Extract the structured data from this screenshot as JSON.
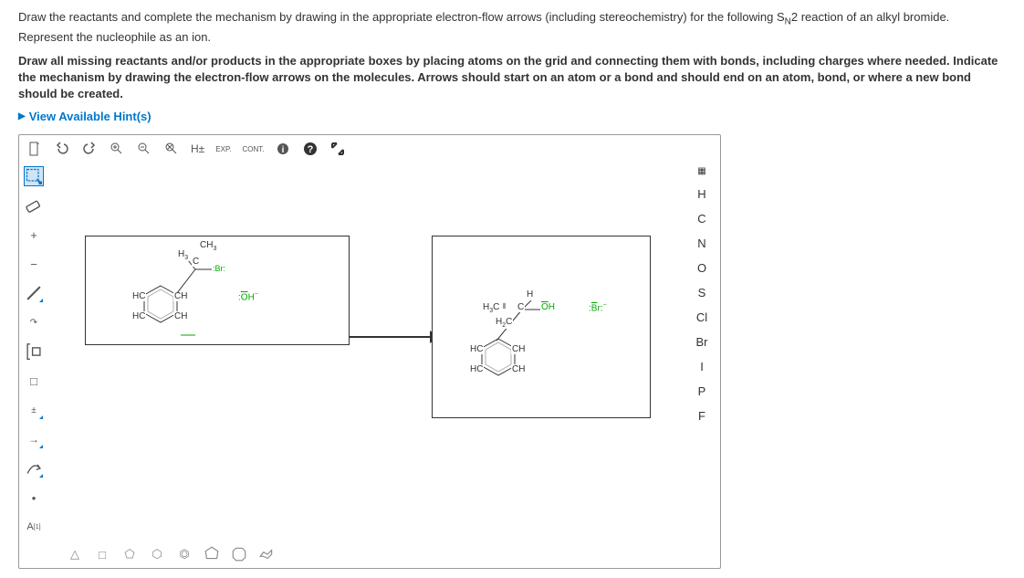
{
  "question": {
    "line1_a": "Draw the reactants and complete the mechanism by drawing in the appropriate electron-flow arrows (including stereochemistry) for the following S",
    "line1_sub": "N",
    "line1_b": "2 reaction of an alkyl bromide. Represent the nucleophile as an ion.",
    "line2": "Draw all missing reactants and/or products in the appropriate boxes by placing atoms on the grid and connecting them with bonds, including charges where needed. Indicate the mechanism by drawing the electron-flow arrows on the molecules. Arrows should start on an atom or a bond and should end on an atom, bond, or where a new bond should be created."
  },
  "hints_label": "View Available Hint(s)",
  "toolbar": {
    "new": "new",
    "undo": "undo",
    "redo": "redo",
    "zoomin": "zoom-in",
    "zoomout": "zoom-out",
    "zoomfit": "zoom-fit",
    "hplus": "H±",
    "exp": "EXP.",
    "cont": "CONT.",
    "info": "info",
    "help": "?",
    "expand": "expand"
  },
  "left_tools": {
    "marquee": "marquee",
    "erase": "erase",
    "plus": "+",
    "minus": "−",
    "single": "/",
    "double": "//",
    "square": "[",
    "rect": "□",
    "charge": "±",
    "arrow": "→",
    "curve": "curve",
    "dot": "•",
    "alabel": "A"
  },
  "elements": {
    "periodic": "⠿",
    "H": "H",
    "C": "C",
    "N": "N",
    "O": "O",
    "S": "S",
    "Cl": "Cl",
    "Br": "Br",
    "I": "I",
    "P": "P",
    "F": "F"
  },
  "shapes": {
    "tri": "△",
    "sq": "□",
    "pent": "⬠",
    "hex": "⬡",
    "benz": "⏣",
    "hep": "⬡",
    "oct": "⬡",
    "chair": "chair"
  },
  "mol_left": {
    "ch3": "CH",
    "h3": "H",
    "br": "Br:",
    "hc1": "HC",
    "hc2": "HC",
    "ch1": "CH",
    "ch2": "CH",
    "oh": ":OH",
    "minus": "−"
  },
  "mol_right": {
    "h": "H",
    "h3c": "H₃C",
    "c": "C",
    "oh": "OH",
    "h2c": "H₂C",
    "hc1": "HC",
    "hc2": "HC",
    "ch1": "CH",
    "ch2": "CH",
    "br": ":Br:",
    "minus": "−"
  },
  "alabel_sup": "[1]"
}
